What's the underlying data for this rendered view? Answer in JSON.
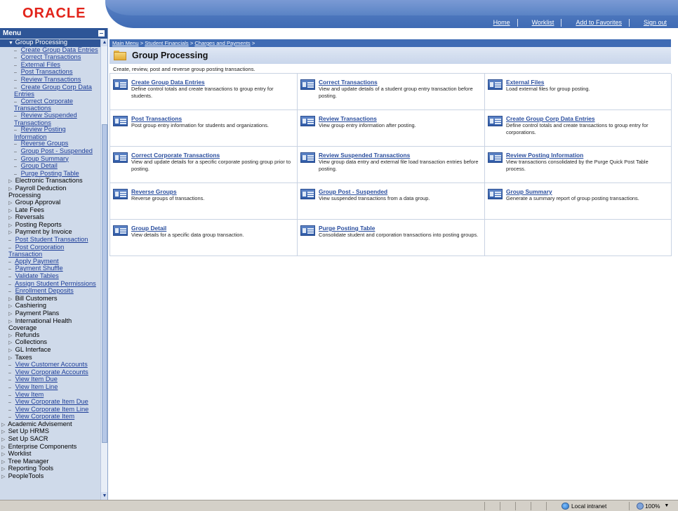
{
  "header": {
    "logo": "ORACLE",
    "links": [
      "Home",
      "Worklist",
      "Add to Favorites",
      "Sign out"
    ]
  },
  "menu": {
    "title": "Menu",
    "items": [
      {
        "label": "Group Processing",
        "level": 0,
        "type": "active",
        "sym": "▼"
      },
      {
        "label": "Create Group Data Entries",
        "level": 2,
        "type": "link",
        "sym": "–"
      },
      {
        "label": "Correct Transactions",
        "level": 2,
        "type": "link",
        "sym": "–"
      },
      {
        "label": "External Files",
        "level": 2,
        "type": "link",
        "sym": "–"
      },
      {
        "label": "Post Transactions",
        "level": 2,
        "type": "link",
        "sym": "–"
      },
      {
        "label": "Review Transactions",
        "level": 2,
        "type": "link",
        "sym": "–"
      },
      {
        "label": "Create Group Corp Data Entries",
        "level": 2,
        "type": "link",
        "sym": "–"
      },
      {
        "label": "Correct Corporate Transactions",
        "level": 2,
        "type": "link",
        "sym": "–"
      },
      {
        "label": "Review Suspended Transactions",
        "level": 2,
        "type": "link",
        "sym": "–"
      },
      {
        "label": "Review Posting Information",
        "level": 2,
        "type": "link",
        "sym": "–"
      },
      {
        "label": "Reverse Groups",
        "level": 2,
        "type": "link",
        "sym": "–"
      },
      {
        "label": "Group Post - Suspended",
        "level": 2,
        "type": "link",
        "sym": "–"
      },
      {
        "label": "Group Summary",
        "level": 2,
        "type": "link",
        "sym": "–"
      },
      {
        "label": "Group Detail",
        "level": 2,
        "type": "link",
        "sym": "–"
      },
      {
        "label": "Purge Posting Table",
        "level": 2,
        "type": "link",
        "sym": "–"
      },
      {
        "label": "Electronic Transactions",
        "level": 1,
        "type": "folder",
        "sym": "▷"
      },
      {
        "label": "Payroll Deduction Processing",
        "level": 1,
        "type": "folder",
        "sym": "▷"
      },
      {
        "label": "Group Approval",
        "level": 1,
        "type": "folder",
        "sym": "▷"
      },
      {
        "label": "Late Fees",
        "level": 1,
        "type": "folder",
        "sym": "▷"
      },
      {
        "label": "Reversals",
        "level": 1,
        "type": "folder",
        "sym": "▷"
      },
      {
        "label": "Posting Reports",
        "level": 1,
        "type": "folder",
        "sym": "▷"
      },
      {
        "label": "Payment by Invoice",
        "level": 1,
        "type": "folder",
        "sym": "▷"
      },
      {
        "label": "Post Student Transaction",
        "level": 1,
        "type": "link",
        "sym": "–"
      },
      {
        "label": "Post Corporation Transaction",
        "level": 1,
        "type": "link",
        "sym": "–"
      },
      {
        "label": "Apply Payment",
        "level": 1,
        "type": "link",
        "sym": "–"
      },
      {
        "label": "Payment Shuffle",
        "level": 1,
        "type": "link",
        "sym": "–"
      },
      {
        "label": "Validate Tables",
        "level": 1,
        "type": "link",
        "sym": "–"
      },
      {
        "label": "Assign Student Permissions",
        "level": 1,
        "type": "link",
        "sym": "–"
      },
      {
        "label": "Enrollment Deposits",
        "level": 1,
        "type": "link",
        "sym": "–"
      },
      {
        "label": "Bill Customers",
        "level": 0,
        "type": "folder",
        "sym": "▷",
        "indent": 1
      },
      {
        "label": "Cashiering",
        "level": 0,
        "type": "folder",
        "sym": "▷",
        "indent": 1
      },
      {
        "label": "Payment Plans",
        "level": 0,
        "type": "folder",
        "sym": "▷",
        "indent": 1
      },
      {
        "label": "International Health Coverage",
        "level": 0,
        "type": "folder",
        "sym": "▷",
        "indent": 1
      },
      {
        "label": "Refunds",
        "level": 0,
        "type": "folder",
        "sym": "▷",
        "indent": 1
      },
      {
        "label": "Collections",
        "level": 0,
        "type": "folder",
        "sym": "▷",
        "indent": 1
      },
      {
        "label": "GL Interface",
        "level": 0,
        "type": "folder",
        "sym": "▷",
        "indent": 1
      },
      {
        "label": "Taxes",
        "level": 0,
        "type": "folder",
        "sym": "▷",
        "indent": 1
      },
      {
        "label": "View Customer Accounts",
        "level": 0,
        "type": "link",
        "sym": "–",
        "indent": 1
      },
      {
        "label": "View Corporate Accounts",
        "level": 0,
        "type": "link",
        "sym": "–",
        "indent": 1
      },
      {
        "label": "View Item Due",
        "level": 0,
        "type": "link",
        "sym": "–",
        "indent": 1
      },
      {
        "label": "View Item Line",
        "level": 0,
        "type": "link",
        "sym": "–",
        "indent": 1
      },
      {
        "label": "View Item",
        "level": 0,
        "type": "link",
        "sym": "–",
        "indent": 1
      },
      {
        "label": "View Corporate Item Due",
        "level": 0,
        "type": "link",
        "sym": "–",
        "indent": 1
      },
      {
        "label": "View Corporate Item Line",
        "level": 0,
        "type": "link",
        "sym": "–",
        "indent": 1
      },
      {
        "label": "View Corporate Item",
        "level": 0,
        "type": "link",
        "sym": "–",
        "indent": 1
      },
      {
        "label": "Academic Advisement",
        "level": 0,
        "type": "folder",
        "sym": "▷"
      },
      {
        "label": "Set Up HRMS",
        "level": 0,
        "type": "folder",
        "sym": "▷"
      },
      {
        "label": "Set Up SACR",
        "level": 0,
        "type": "folder",
        "sym": "▷"
      },
      {
        "label": "Enterprise Components",
        "level": 0,
        "type": "folder",
        "sym": "▷"
      },
      {
        "label": "Worklist",
        "level": 0,
        "type": "folder",
        "sym": "▷"
      },
      {
        "label": "Tree Manager",
        "level": 0,
        "type": "folder",
        "sym": "▷"
      },
      {
        "label": "Reporting Tools",
        "level": 0,
        "type": "folder",
        "sym": "▷"
      },
      {
        "label": "PeopleTools",
        "level": 0,
        "type": "folder",
        "sym": "▷"
      }
    ]
  },
  "main": {
    "breadcrumb": [
      "Main Menu",
      "Student Financials",
      "Charges and Payments"
    ],
    "breadcrumb_sep": " > ",
    "title": "Group Processing",
    "description": "Create, review, post and reverse group posting transactions.",
    "cells": [
      {
        "title": "Create Group Data Entries",
        "desc": "Define control totals and create transactions to group entry for students."
      },
      {
        "title": "Correct Transactions",
        "desc": "View and update details of a student group entry transaction before posting."
      },
      {
        "title": "External Files",
        "desc": "Load external files for group posting."
      },
      {
        "title": "Post Transactions",
        "desc": "Post group entry information for students and organizations."
      },
      {
        "title": "Review Transactions",
        "desc": "View group entry information after posting."
      },
      {
        "title": "Create Group Corp Data Entries",
        "desc": "Define control totals and create transactions to group entry for corporations."
      },
      {
        "title": "Correct Corporate Transactions",
        "desc": "View and update details for a specific corporate posting group prior to posting."
      },
      {
        "title": "Review Suspended Transactions",
        "desc": "View group data entry and external file load transaction entries before posting."
      },
      {
        "title": "Review Posting Information",
        "desc": "View transactions consolidated by the Purge Quick Post Table process."
      },
      {
        "title": "Reverse Groups",
        "desc": "Reverse groups of transactions."
      },
      {
        "title": "Group Post - Suspended",
        "desc": "View suspended transactions from a data group."
      },
      {
        "title": "Group Summary",
        "desc": "Generate a summary report of group posting transactions."
      },
      {
        "title": "Group Detail",
        "desc": "View details for a specific data group transaction."
      },
      {
        "title": "Purge Posting Table",
        "desc": "Consolidate student and corporation transactions into posting groups."
      },
      null
    ]
  },
  "statusbar": {
    "zone": "Local intranet",
    "zoom": "100%"
  },
  "colors": {
    "brand_red": "#e2231a",
    "nav_blue": "#3f6bb4",
    "menu_bg": "#cfdaea",
    "link_blue": "#2a4e9e"
  }
}
